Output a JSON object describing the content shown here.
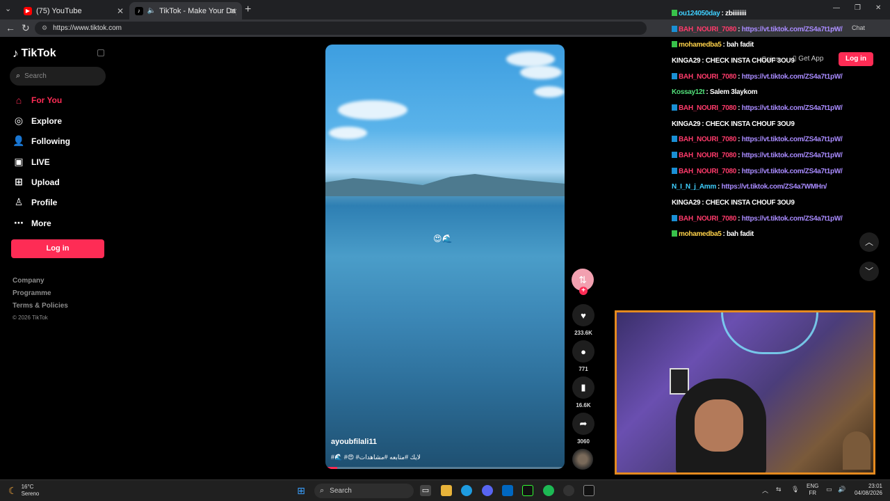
{
  "browser": {
    "tabs": [
      {
        "label": "(75) YouTube",
        "favicon": "youtube-icon"
      },
      {
        "label": "TikTok - Make Your Day",
        "favicon": "tiktok-icon"
      }
    ],
    "url": "https://www.tiktok.com",
    "chat_label": "Chat"
  },
  "sidebar": {
    "logo": "TikTok",
    "search_placeholder": "Search",
    "items": [
      {
        "label": "For You",
        "icon": "home-icon"
      },
      {
        "label": "Explore",
        "icon": "compass-icon"
      },
      {
        "label": "Following",
        "icon": "following-icon"
      },
      {
        "label": "LIVE",
        "icon": "live-icon"
      },
      {
        "label": "Upload",
        "icon": "upload-icon"
      },
      {
        "label": "Profile",
        "icon": "profile-icon"
      },
      {
        "label": "More",
        "icon": "more-icon"
      }
    ],
    "login": "Log in",
    "footer": [
      "Company",
      "Programme",
      "Terms & Policies"
    ],
    "copyright": "© 2026 TikTok"
  },
  "video": {
    "author": "ayoubfilali11",
    "caption": "#🌊 #😍 #لايك #متابعه #مشاهدات",
    "emoji": "😍🌊",
    "progress": 0.05
  },
  "actions": {
    "likes": "233.6K",
    "comments": "771",
    "saves": "16.6K",
    "shares": "3060"
  },
  "header_right": {
    "coins": "Coins",
    "get_app": "Get App",
    "login": "Log in"
  },
  "chat": [
    {
      "user": "ou124050day",
      "msg": "zbiiiiiiii",
      "color": "#3fd0ff",
      "badge": "g"
    },
    {
      "user": "BAH_NOURI_7080",
      "msg": "https://vt.tiktok.com/ZS4a7t1pW/",
      "color": "#ff3b6b",
      "link": true
    },
    {
      "user": "mohamedba5",
      "msg": "bah fadit",
      "color": "#ffd24a",
      "badge": "g"
    },
    {
      "user": "KINGA29",
      "msg": "CHECK INSTA CHOUF 3OU9",
      "color": "#ffffff",
      "nobadge": true
    },
    {
      "user": "BAH_NOURI_7080",
      "msg": "https://vt.tiktok.com/ZS4a7t1pW/",
      "color": "#ff3b6b",
      "link": true
    },
    {
      "user": "Kossay12t",
      "msg": "Salem 3laykom",
      "color": "#52e07a",
      "nobadge": true
    },
    {
      "user": "BAH_NOURI_7080",
      "msg": "https://vt.tiktok.com/ZS4a7t1pW/",
      "color": "#ff3b6b",
      "link": true
    },
    {
      "user": "KINGA29",
      "msg": "CHECK INSTA CHOUF 3OU9",
      "color": "#ffffff",
      "nobadge": true
    },
    {
      "user": "BAH_NOURI_7080",
      "msg": "https://vt.tiktok.com/ZS4a7t1pW/",
      "color": "#ff3b6b",
      "link": true
    },
    {
      "user": "BAH_NOURI_7080",
      "msg": "https://vt.tiktok.com/ZS4a7t1pW/",
      "color": "#ff3b6b",
      "link": true
    },
    {
      "user": "BAH_NOURI_7080",
      "msg": "https://vt.tiktok.com/ZS4a7t1pW/",
      "color": "#ff3b6b",
      "link": true
    },
    {
      "user": "N_I_N_j_Amm",
      "msg": "https://vt.tiktok.com/ZS4a7WMHn/",
      "color": "#3fd0ff",
      "link": true,
      "nobadge": true
    },
    {
      "user": "KINGA29",
      "msg": "CHECK INSTA CHOUF 3OU9",
      "color": "#ffffff",
      "nobadge": true
    },
    {
      "user": "BAH_NOURI_7080",
      "msg": "https://vt.tiktok.com/ZS4a7t1pW/",
      "color": "#ff3b6b",
      "link": true
    },
    {
      "user": "mohamedba5",
      "msg": "bah fadit",
      "color": "#ffd24a",
      "badge": "g"
    }
  ],
  "taskbar": {
    "weather_temp": "16°C",
    "weather_desc": "Sereno",
    "search": "Search",
    "lang_top": "ENG",
    "lang_bottom": "FR",
    "time": "23:01",
    "date": "04/08/2026"
  },
  "colors": {
    "accent": "#fe2c55",
    "webcam_border": "#e58a1f"
  }
}
